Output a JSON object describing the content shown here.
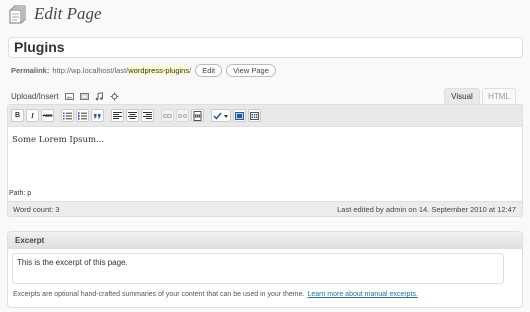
{
  "header": {
    "title": "Edit Page",
    "icon": "pages-icon"
  },
  "post": {
    "title": "Plugins"
  },
  "permalink": {
    "label": "Permalink:",
    "base": "http://wp.localhost/last/",
    "slug": "wordpress-plugins",
    "trail": "/",
    "edit_label": "Edit",
    "view_label": "View Page"
  },
  "media": {
    "label": "Upload/Insert",
    "icons": [
      "image-icon",
      "video-icon",
      "audio-icon",
      "media-icon"
    ]
  },
  "tabs": {
    "visual": "Visual",
    "html": "HTML",
    "active": "Visual"
  },
  "toolbar": {
    "buttons": [
      "bold",
      "italic",
      "strikethrough",
      "bullet-list",
      "numbered-list",
      "blockquote",
      "align-left",
      "align-center",
      "align-right",
      "link",
      "unlink",
      "more",
      "spellcheck",
      "fullscreen",
      "kitchen-sink"
    ],
    "bold_glyph": "B",
    "italic_glyph": "I",
    "strike_glyph": "ABC"
  },
  "editor": {
    "content": "Some Lorem Ipsum...",
    "path": "Path: p",
    "word_count": "Word count: 3",
    "last_edited": "Last edited by admin on 14. September 2010 at 12:47"
  },
  "excerpt": {
    "heading": "Excerpt",
    "value": "This is the excerpt of this page.",
    "help": "Excerpts are optional hand-crafted summaries of your content that can be used in your theme.",
    "help_link": "Learn more about manual excerpts."
  },
  "colors": {
    "link": "#21759b",
    "slug_highlight": "#fffbcc",
    "toolbar_bg": "#e9e9e9"
  }
}
